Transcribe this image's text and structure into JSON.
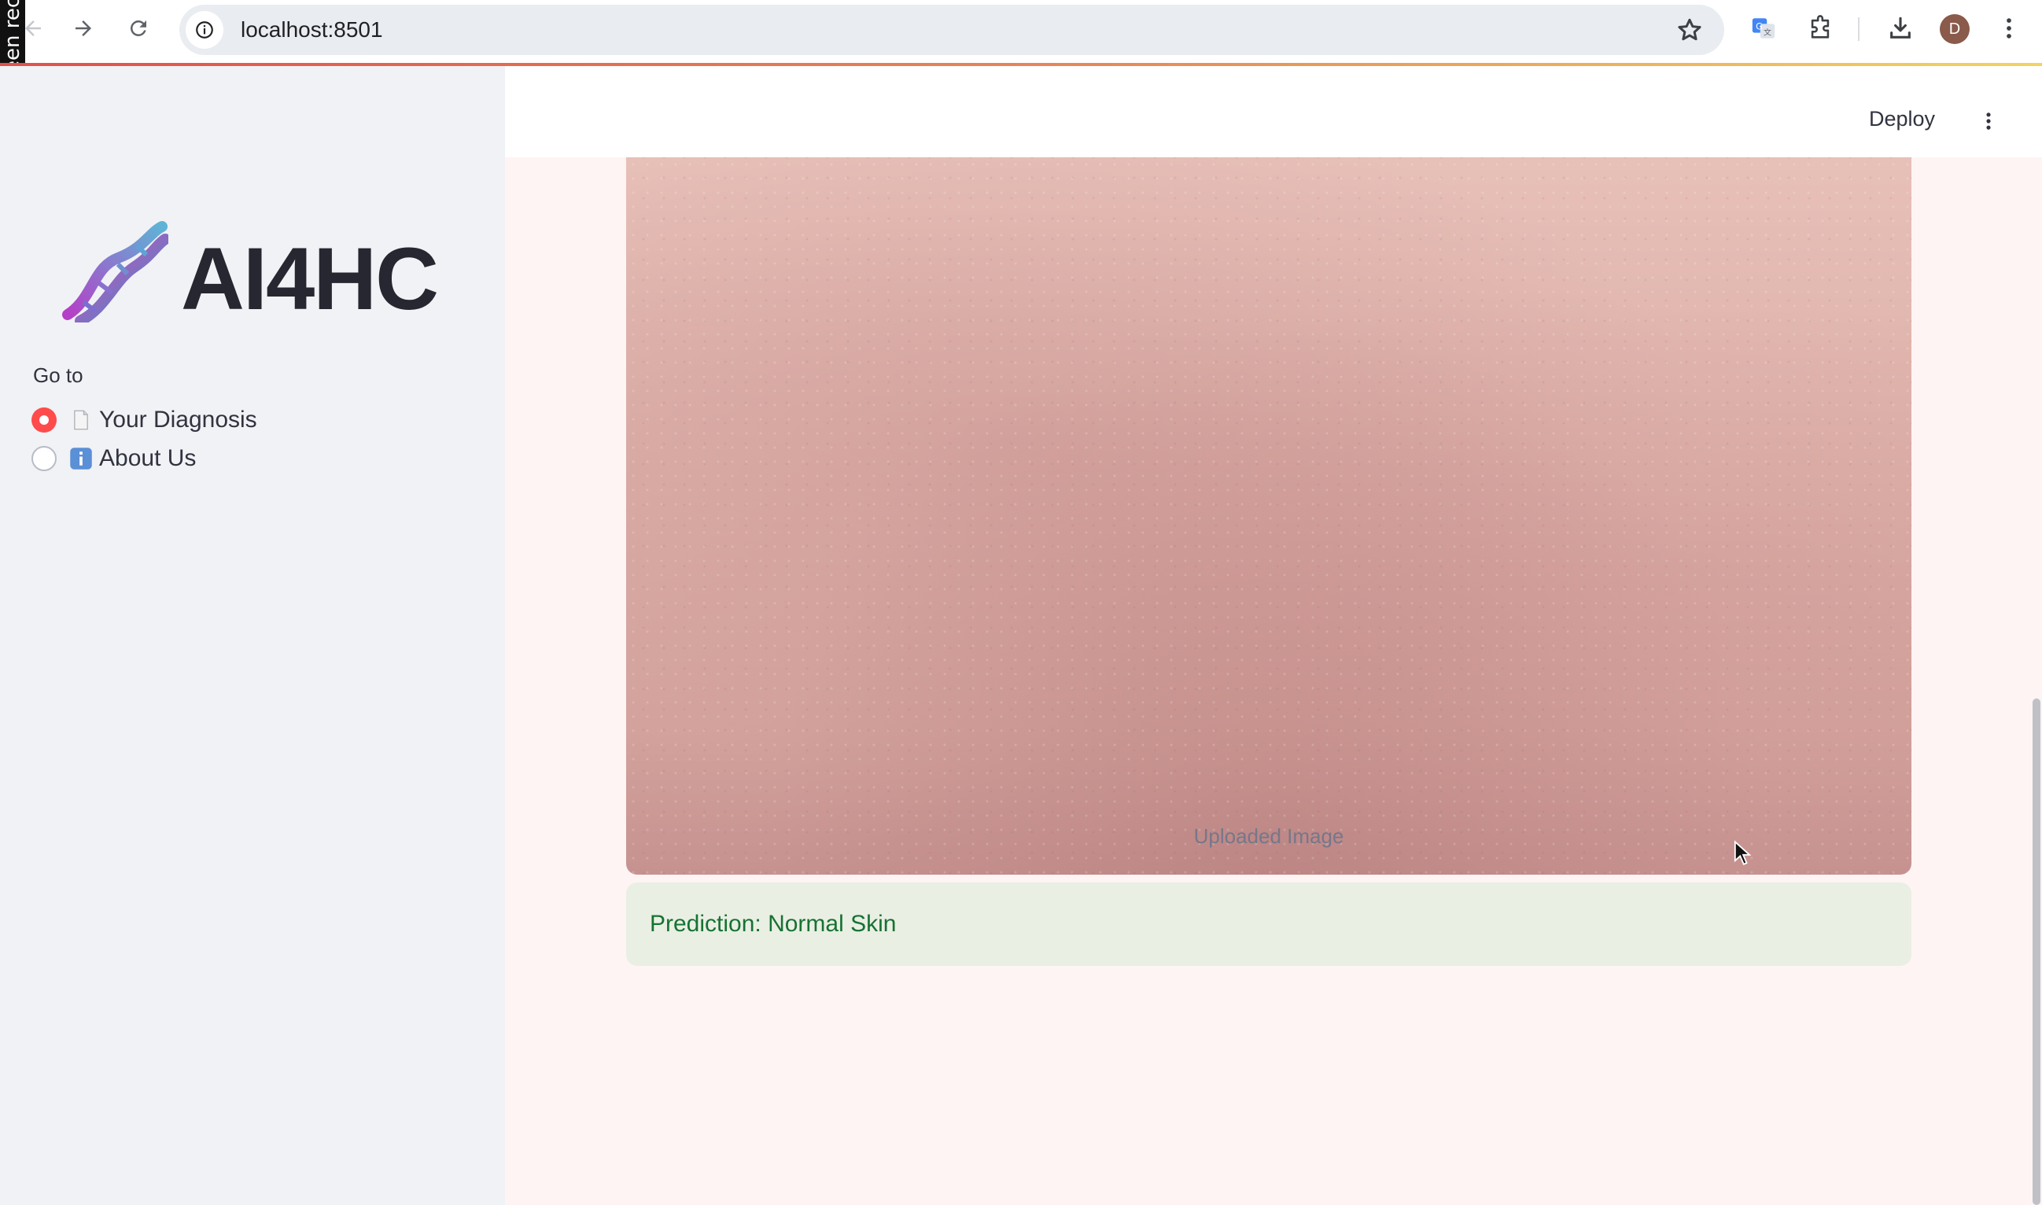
{
  "browser": {
    "url": "localhost:8501",
    "recording_tab": "een rec",
    "profile_initial": "D"
  },
  "sidebar": {
    "app_title": "AI4HC",
    "nav_label": "Go to",
    "options": [
      {
        "label": "Your Diagnosis",
        "icon": "page-icon",
        "selected": true
      },
      {
        "label": "About Us",
        "icon": "info-icon",
        "selected": false
      }
    ]
  },
  "header": {
    "deploy_label": "Deploy"
  },
  "main": {
    "image_caption": "Uploaded Image",
    "prediction_text": "Prediction: Normal Skin"
  },
  "colors": {
    "accent": "#ff4b4b",
    "sidebar_bg": "#f0f2f6",
    "main_bg": "#fdf4f3",
    "success_bg": "#e9efe3",
    "success_text": "#177233"
  }
}
